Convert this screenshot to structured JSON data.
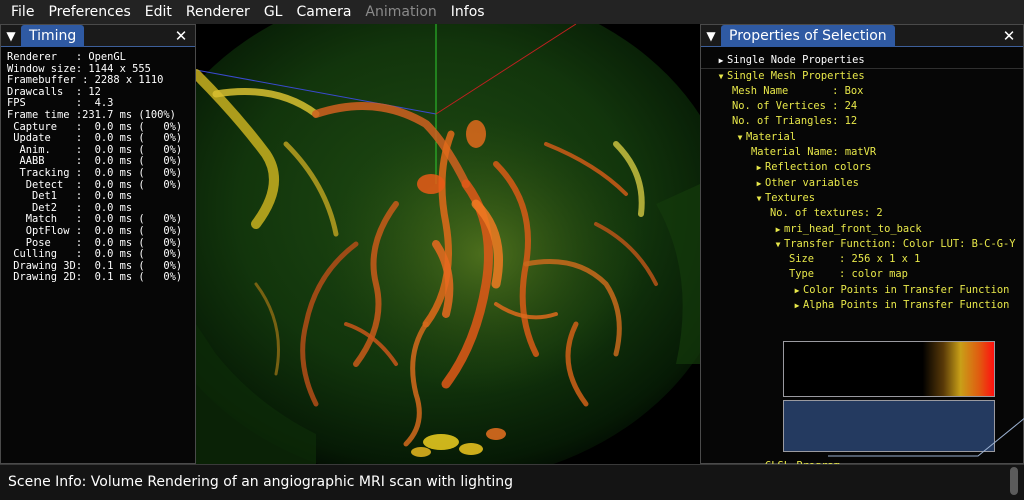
{
  "menubar": {
    "items": [
      {
        "label": "File",
        "enabled": true
      },
      {
        "label": "Preferences",
        "enabled": true
      },
      {
        "label": "Edit",
        "enabled": true
      },
      {
        "label": "Renderer",
        "enabled": true
      },
      {
        "label": "GL",
        "enabled": true
      },
      {
        "label": "Camera",
        "enabled": true
      },
      {
        "label": "Animation",
        "enabled": false
      },
      {
        "label": "Infos",
        "enabled": true
      }
    ]
  },
  "timing": {
    "title": "Timing",
    "collapse_icon": "triangle-down-icon",
    "close_icon": "close-icon",
    "lines": [
      "Renderer   : OpenGL",
      "Window size: 1144 x 555",
      "Framebuffer : 2288 x 1110",
      "Drawcalls  : 12",
      "FPS        :  4.3",
      "Frame time :231.7 ms (100%)",
      " Capture   :  0.0 ms (   0%)",
      " Update    :  0.0 ms (   0%)",
      "  Anim.    :  0.0 ms (   0%)",
      "  AABB     :  0.0 ms (   0%)",
      "  Tracking :  0.0 ms (   0%)",
      "   Detect  :  0.0 ms (   0%)",
      "    Det1   :  0.0 ms",
      "    Det2   :  0.0 ms",
      "   Match   :  0.0 ms (   0%)",
      "   OptFlow :  0.0 ms (   0%)",
      "   Pose    :  0.0 ms (   0%)",
      " Culling   :  0.0 ms (   0%)",
      " Drawing 3D:  0.1 ms (   0%)",
      " Drawing 2D:  0.1 ms (   0%)"
    ]
  },
  "properties": {
    "title": "Properties of Selection",
    "collapse_icon": "triangle-down-icon",
    "close_icon": "close-icon",
    "rows": [
      {
        "indent": 0,
        "arrow": "right",
        "text": "Single Node Properties",
        "color": "white",
        "interactable": true
      },
      {
        "indent": 0,
        "arrow": "down",
        "text": "Single Mesh Properties",
        "color": "yellow",
        "interactable": true
      },
      {
        "indent": 1,
        "arrow": "",
        "text": "Mesh Name       : Box",
        "color": "yellow",
        "interactable": false
      },
      {
        "indent": 1,
        "arrow": "",
        "text": "No. of Vertices : 24",
        "color": "yellow",
        "interactable": false
      },
      {
        "indent": 1,
        "arrow": "",
        "text": "No. of Triangles: 12",
        "color": "yellow",
        "interactable": false
      },
      {
        "indent": 1,
        "arrow": "down",
        "text": "Material",
        "color": "yellow",
        "interactable": true
      },
      {
        "indent": 2,
        "arrow": "",
        "text": "Material Name: matVR",
        "color": "yellow",
        "interactable": false
      },
      {
        "indent": 2,
        "arrow": "right",
        "text": "Reflection colors",
        "color": "yellow",
        "interactable": true
      },
      {
        "indent": 2,
        "arrow": "right",
        "text": "Other variables",
        "color": "yellow",
        "interactable": true
      },
      {
        "indent": 2,
        "arrow": "down",
        "text": "Textures",
        "color": "yellow",
        "interactable": true
      },
      {
        "indent": 3,
        "arrow": "",
        "text": "No. of textures: 2",
        "color": "yellow",
        "interactable": false
      },
      {
        "indent": 3,
        "arrow": "right",
        "text": "mri_head_front_to_back",
        "color": "yellow",
        "interactable": true
      },
      {
        "indent": 3,
        "arrow": "down",
        "text": "Transfer Function: Color LUT: B-C-G-Y",
        "color": "yellow",
        "interactable": true
      },
      {
        "indent": 4,
        "arrow": "",
        "text": "Size    : 256 x 1 x 1",
        "color": "yellow",
        "interactable": false
      },
      {
        "indent": 4,
        "arrow": "",
        "text": "Type    : color map",
        "color": "yellow",
        "interactable": false
      },
      {
        "indent": 4,
        "arrow": "right",
        "text": "Color Points in Transfer Function",
        "color": "yellow",
        "interactable": true
      },
      {
        "indent": 4,
        "arrow": "right",
        "text": "Alpha Points in Transfer Function",
        "color": "yellow",
        "interactable": true
      },
      {
        "indent": 2,
        "arrow": "right",
        "text": "GLSL Program",
        "color": "yellow",
        "interactable": true
      }
    ]
  },
  "statusbar": {
    "text": "Scene Info: Volume Rendering of an angiographic MRI scan with lighting"
  },
  "colors": {
    "menubar_bg": "#232323",
    "title_tab": "#2f5aa3",
    "tree_text": "#e8e84a",
    "alpha_plot_bg": "#243a60"
  }
}
